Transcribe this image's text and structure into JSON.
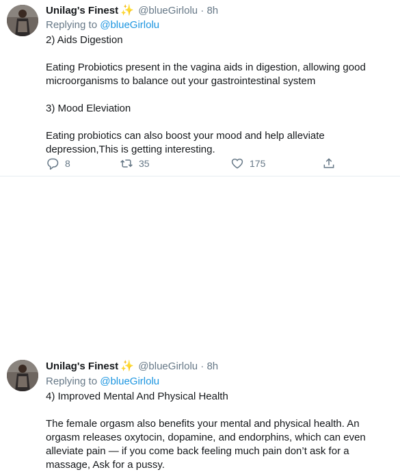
{
  "tweets": [
    {
      "author_name": "Unilag's Finest",
      "emoji": "✨",
      "handle": "@blueGirlolu",
      "dot": "·",
      "time": "8h",
      "replying_prefix": "Replying to",
      "replying_to": "@blueGirlolu",
      "lines": [
        "2) Aids Digestion",
        "",
        "Eating Probiotics present in the vagina aids in digestion, allowing good microorganisms to balance out your gastrointestinal system",
        "",
        "3) Mood Eleviation",
        "",
        "Eating probiotics can also boost your mood and help alleviate depression,This is getting interesting."
      ],
      "replies": "8",
      "retweets": "35",
      "likes": "175"
    },
    {
      "author_name": "Unilag's Finest",
      "emoji": "✨",
      "handle": "@blueGirlolu",
      "dot": "·",
      "time": "8h",
      "replying_prefix": "Replying to",
      "replying_to": "@blueGirlolu",
      "lines": [
        "4) Improved Mental And Physical Health",
        "",
        "The female orgasm also benefits your mental and physical health. An orgasm releases oxytocin, dopamine, and endorphins, which can even alleviate pain — if you come back feeling much pain don’t ask for a massage, Ask for a pussy."
      ]
    }
  ],
  "icons": {
    "reply": "reply-icon",
    "retweet": "retweet-icon",
    "like": "heart-icon",
    "share": "share-icon"
  },
  "colors": {
    "link": "#1b95e0",
    "muted": "#657786",
    "text": "#14171a",
    "divider": "#e6ecf0"
  }
}
